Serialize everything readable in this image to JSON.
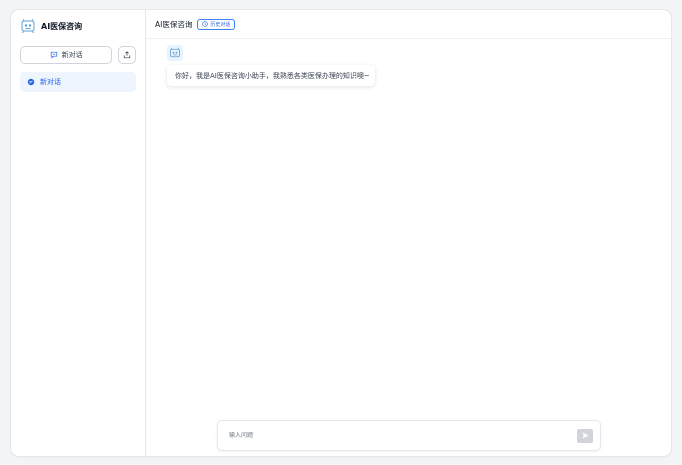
{
  "sidebar": {
    "brand_title": "AI医保咨询",
    "new_chat_label": "新对话",
    "sessions": [
      {
        "label": "新对话"
      }
    ]
  },
  "main": {
    "title": "AI医保咨询",
    "history_label": "历史对话",
    "messages": [
      {
        "role": "assistant",
        "text": "你好，我是AI医保咨询小助手，我熟悉各类医保办理的知识噢~"
      }
    ]
  },
  "input": {
    "placeholder": "输入问题"
  },
  "colors": {
    "accent": "#2563eb",
    "selected_bg": "#eef5fd"
  }
}
